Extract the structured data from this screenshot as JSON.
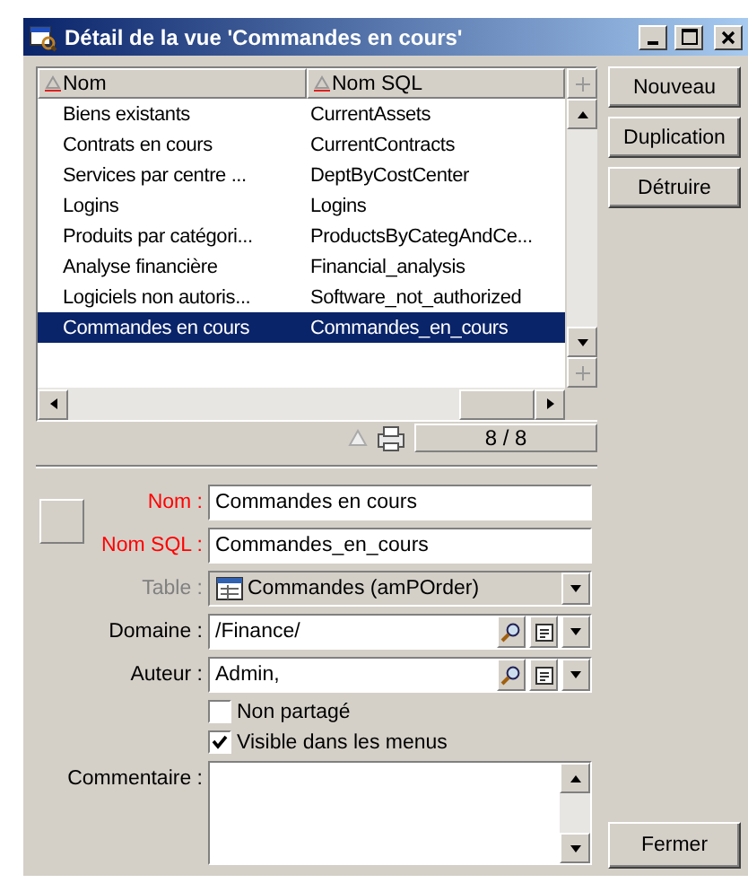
{
  "window": {
    "title": "Détail de la vue 'Commandes en cours'"
  },
  "list": {
    "columns": [
      "Nom",
      "Nom SQL"
    ],
    "rows": [
      {
        "name": "Biens existants",
        "sql_name": "CurrentAssets",
        "selected": false
      },
      {
        "name": "Contrats en cours",
        "sql_name": "CurrentContracts",
        "selected": false
      },
      {
        "name": "Services par centre ...",
        "sql_name": "DeptByCostCenter",
        "selected": false
      },
      {
        "name": "Logins",
        "sql_name": "Logins",
        "selected": false
      },
      {
        "name": "Produits par catégori...",
        "sql_name": "ProductsByCategAndCe...",
        "selected": false
      },
      {
        "name": "Analyse financière",
        "sql_name": "Financial_analysis",
        "selected": false
      },
      {
        "name": "Logiciels non autoris...",
        "sql_name": "Software_not_authorized",
        "selected": false
      },
      {
        "name": "Commandes en cours",
        "sql_name": "Commandes_en_cours",
        "selected": true
      }
    ],
    "counter": "8 / 8"
  },
  "buttons": [
    {
      "label": "Nouveau"
    },
    {
      "label": "Duplication"
    },
    {
      "label": "Détruire"
    }
  ],
  "form": {
    "fields": [
      {
        "kind": "text",
        "label": "Nom :",
        "value": "Commandes en cours",
        "required": true,
        "disabled": false
      },
      {
        "kind": "text",
        "label": "Nom SQL :",
        "value": "Commandes_en_cours",
        "required": true,
        "disabled": false
      },
      {
        "kind": "combo",
        "label": "Table :",
        "value": "Commandes (amPOrder)",
        "required": false,
        "disabled": true
      },
      {
        "kind": "link",
        "label": "Domaine :",
        "value": "/Finance/",
        "required": false,
        "disabled": false
      },
      {
        "kind": "link",
        "label": "Auteur :",
        "value": "Admin,",
        "required": false,
        "disabled": false
      }
    ],
    "checkboxes": [
      {
        "label": "Non partagé",
        "checked": false
      },
      {
        "label": "Visible dans les menus",
        "checked": true
      }
    ],
    "comment": {
      "label": "Commentaire :"
    }
  },
  "close_button": {
    "label": "Fermer"
  }
}
